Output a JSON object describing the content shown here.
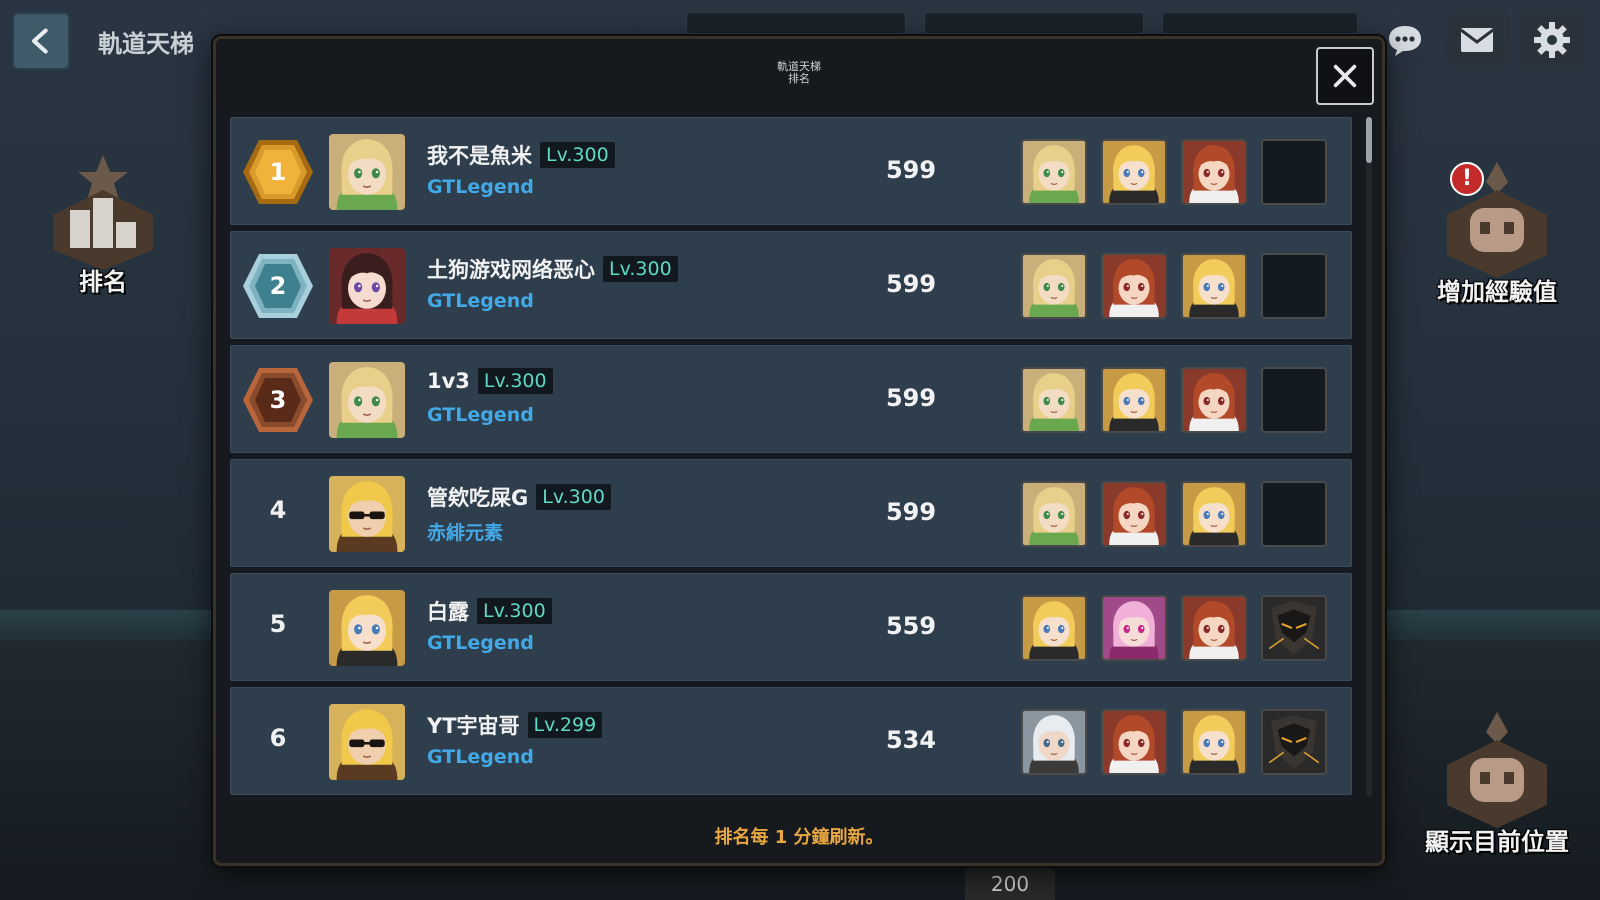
{
  "header": {
    "back_icon": "chevron-left-icon",
    "title": "軌道天梯",
    "icons": [
      "chat-icon",
      "mail-icon",
      "gear-icon"
    ]
  },
  "side_left": {
    "label": "排名",
    "icon": "ranking-podium-icon"
  },
  "side_right_top": {
    "label": "增加經驗值",
    "icon": "robot-emblem-icon",
    "alert": "!"
  },
  "side_right_bottom": {
    "label": "顯示目前位置",
    "icon": "robot-emblem-icon"
  },
  "bottom_counter": "200",
  "modal": {
    "title_line1": "軌道天梯",
    "title_line2": "排名",
    "close_icon": "close-icon",
    "footer": "排名每 1 分鐘刷新。"
  },
  "colors": {
    "gold": "#d99a2b",
    "silver": "#7fb3c2",
    "bronze": "#8a4a2c",
    "guild_blue": "#43a9e6",
    "level_teal": "#5fdac6",
    "footer_orange": "#e8a640"
  },
  "rows": [
    {
      "rank": "1",
      "badge": "gold",
      "name": "我不是魚米",
      "level": "Lv.300",
      "guild": "GTLegend",
      "score": "599",
      "avatar": "blonde-elf-portrait",
      "team": [
        "blonde-elf-portrait",
        "blonde-knight-portrait",
        "redhead-maid-portrait",
        "empty-slot"
      ]
    },
    {
      "rank": "2",
      "badge": "silver",
      "name": "土狗游戏网络恶心",
      "level": "Lv.300",
      "guild": "GTLegend",
      "score": "599",
      "avatar": "dark-hair-girl-portrait",
      "team": [
        "blonde-elf-portrait",
        "redhead-maid-portrait",
        "blonde-knight-portrait",
        "empty-slot"
      ]
    },
    {
      "rank": "3",
      "badge": "bronze",
      "name": "1v3",
      "level": "Lv.300",
      "guild": "GTLegend",
      "score": "599",
      "avatar": "blonde-elf-portrait",
      "team": [
        "blonde-elf-portrait",
        "blonde-knight-portrait",
        "redhead-maid-portrait",
        "empty-slot"
      ]
    },
    {
      "rank": "4",
      "badge": "none",
      "name": "管欸吃屎G",
      "level": "Lv.300",
      "guild": "赤緋元素",
      "score": "599",
      "avatar": "sunglasses-blonde-portrait",
      "team": [
        "blonde-elf-portrait",
        "redhead-maid-portrait",
        "blonde-knight-portrait",
        "empty-slot"
      ]
    },
    {
      "rank": "5",
      "badge": "none",
      "name": "白露",
      "level": "Lv.300",
      "guild": "GTLegend",
      "score": "559",
      "avatar": "blonde-knight-portrait",
      "team": [
        "blonde-knight-portrait",
        "pink-hair-girl-portrait",
        "redhead-maid-portrait",
        "dark-armor-portrait"
      ]
    },
    {
      "rank": "6",
      "badge": "none",
      "name": "YT宇宙哥",
      "level": "Lv.299",
      "guild": "GTLegend",
      "score": "534",
      "avatar": "sunglasses-blonde-portrait",
      "team": [
        "white-hair-portrait",
        "redhead-maid-portrait",
        "blonde-knight-portrait",
        "dark-armor-portrait"
      ]
    }
  ]
}
